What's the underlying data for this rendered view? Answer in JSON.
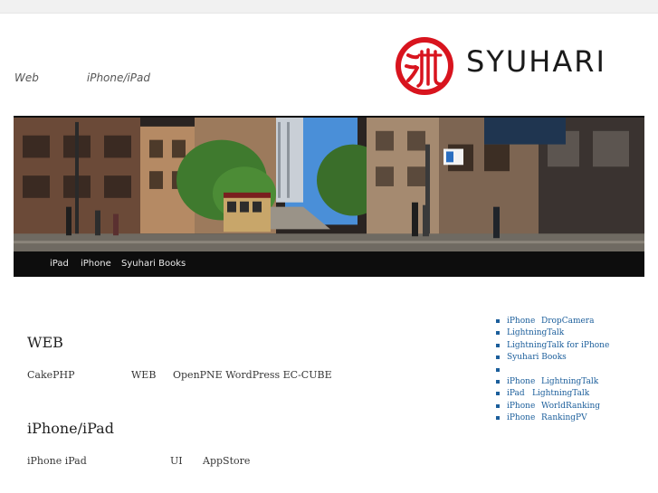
{
  "header": {
    "tagline_1": "Web",
    "tagline_2": "iPhone/iPad",
    "logo_text": "SYUHARI",
    "brand_red": "#d8141e"
  },
  "banner": {
    "icon": "street-photo-icon"
  },
  "nav": {
    "items": [
      "iPad",
      "iPhone",
      "Syuhari Books"
    ]
  },
  "main": {
    "sections": [
      {
        "title": "WEB",
        "words": [
          "CakePHP",
          "WEB",
          "OpenPNE WordPress EC-CUBE"
        ]
      },
      {
        "title": "iPhone/iPad",
        "words": [
          "iPhone iPad",
          "UI",
          "AppStore"
        ]
      }
    ]
  },
  "sidebar": {
    "items": [
      {
        "a": "iPhone",
        "b": "DropCamera"
      },
      {
        "a": "LightningTalk",
        "b": ""
      },
      {
        "a": "LightningTalk for iPhone",
        "b": ""
      },
      {
        "a": "Syuhari Books",
        "b": ""
      },
      {
        "a": "",
        "b": ""
      },
      {
        "a": "iPhone",
        "b": "LightningTalk"
      },
      {
        "a": "iPad",
        "b": "LightningTalk"
      },
      {
        "a": "iPhone",
        "b": "WorldRanking"
      },
      {
        "a": "iPhone",
        "b": "RankingPV"
      }
    ]
  }
}
